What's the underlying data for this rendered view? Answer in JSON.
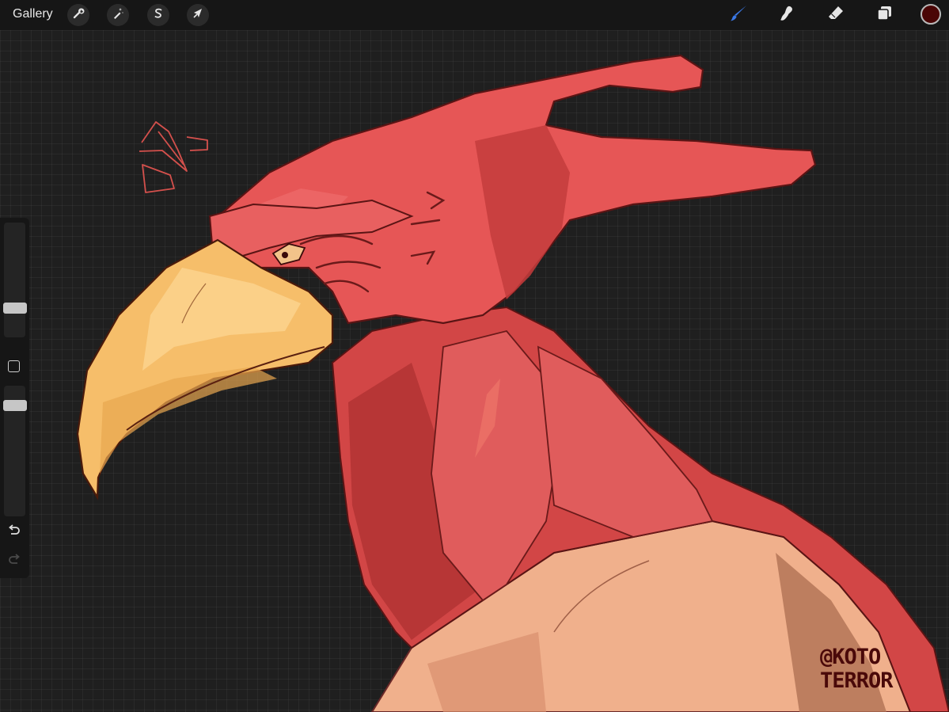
{
  "toolbar": {
    "gallery_label": "Gallery",
    "left_tools": [
      "wrench-icon",
      "magic-wand-icon",
      "selection-s-icon",
      "transform-arrow-icon"
    ],
    "right_tools": [
      "brush-icon",
      "smudge-icon",
      "eraser-icon",
      "layers-icon"
    ],
    "active_tool": "brush-icon",
    "active_tool_color": "#3a78e6",
    "current_color": "#4a0505"
  },
  "sidebar": {
    "brush_size_level": 0.23,
    "opacity_level": 0.88,
    "icons": [
      "modify-square-icon",
      "undo-icon",
      "redo-icon"
    ]
  },
  "signature": {
    "line1": "@KOTO",
    "line2": "TERROR"
  },
  "palette": {
    "feather_red": "#e05454",
    "feather_shadow": "#b93a3a",
    "beak_yellow": "#f6be6a",
    "skin_peach": "#f0b08c",
    "canvas_bg": "#1f1f1f"
  }
}
